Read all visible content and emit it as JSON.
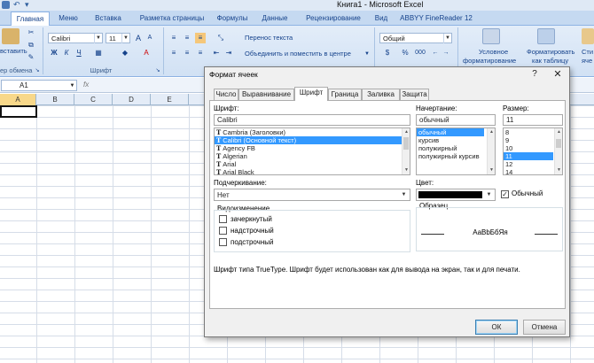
{
  "window": {
    "title": "Книга1 - Microsoft Excel"
  },
  "ribbon_tabs": [
    "Главная",
    "Меню",
    "Вставка",
    "Разметка страницы",
    "Формулы",
    "Данные",
    "Рецензирование",
    "Вид",
    "ABBYY FineReader 12"
  ],
  "ribbon": {
    "paste_label": "вставить",
    "clipboard_label": "ер обмена",
    "font_name": "Calibri",
    "font_size": "11",
    "font_group_label": "Шрифт",
    "wrap_text": "Перенос текста",
    "merge_center": "Объединить и поместить в центре",
    "number_format": "Общий",
    "percent_symbol": "%",
    "thousands_symbol": "000",
    "cond_format_1": "Условное",
    "cond_format_2": "форматирование",
    "format_table_1": "Форматировать",
    "format_table_2": "как таблицу",
    "cell_styles_1": "Сти",
    "cell_styles_2": "яче",
    "bold": "Ж",
    "italic": "К",
    "underline": "Ч"
  },
  "formula_bar": {
    "name_box": "A1",
    "fx_label": "fx"
  },
  "columns": [
    "A",
    "B",
    "C",
    "D",
    "E"
  ],
  "dialog": {
    "title": "Формат ячеек",
    "help": "?",
    "close": "✕",
    "tabs": [
      "Число",
      "Выравнивание",
      "Шрифт",
      "Граница",
      "Заливка",
      "Защита"
    ],
    "active_tab": "Шрифт",
    "font_label": "Шрифт:",
    "font_value": "Calibri",
    "font_list": [
      "Cambria (Заголовки)",
      "Calibri (Основной текст)",
      "Agency FB",
      "Algerian",
      "Arial",
      "Arial Black"
    ],
    "font_selected_index": 1,
    "style_label": "Начертание:",
    "style_value": "обычный",
    "style_list": [
      "обычный",
      "курсив",
      "полужирный",
      "полужирный курсив"
    ],
    "style_selected_index": 0,
    "size_label": "Размер:",
    "size_value": "11",
    "size_list": [
      "8",
      "9",
      "10",
      "11",
      "12",
      "14"
    ],
    "size_selected_index": 3,
    "underline_label": "Подчеркивание:",
    "underline_value": "Нет",
    "color_label": "Цвет:",
    "color_value": "#000000",
    "normal_font_label": "Обычный",
    "normal_font_checked": true,
    "effects_label": "Видоизменение",
    "effects": [
      "зачеркнутый",
      "надстрочный",
      "подстрочный"
    ],
    "preview_label": "Образец",
    "preview_text": "AaBbБбЯя",
    "info_text": "Шрифт типа TrueType. Шрифт будет использован как для вывода на экран, так и для печати.",
    "ok": "ОК",
    "cancel": "Отмена"
  }
}
